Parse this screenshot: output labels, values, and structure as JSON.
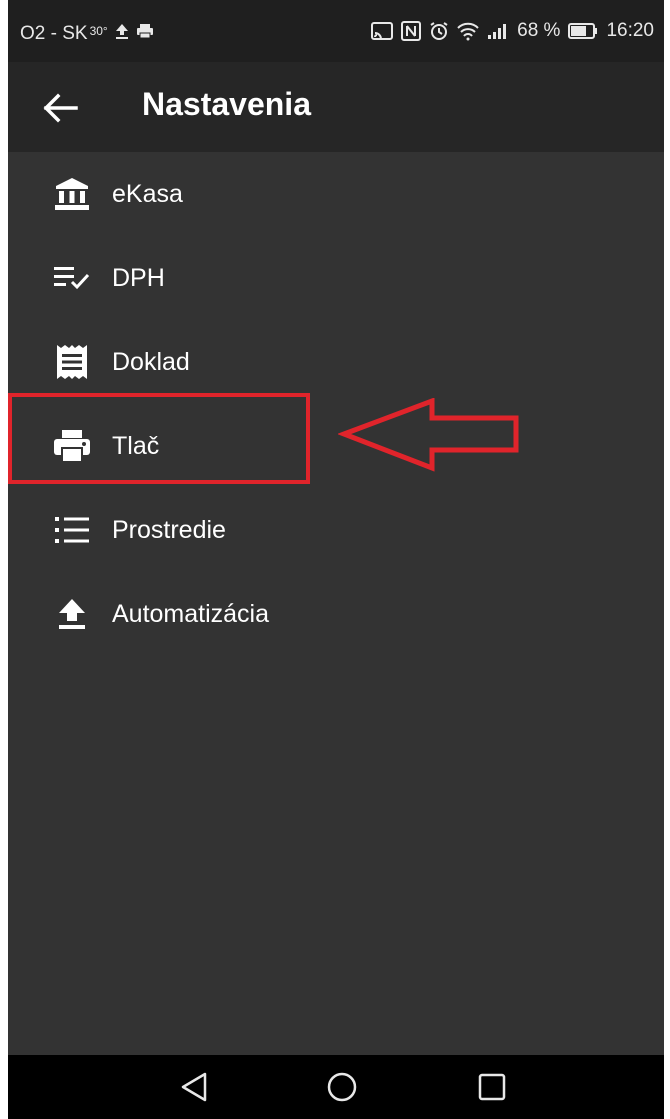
{
  "status_bar": {
    "carrier": "O2 - SK",
    "temperature": "30°",
    "battery": "68 %",
    "time": "16:20"
  },
  "app_bar": {
    "title": "Nastavenia",
    "back_icon": "arrow-left-icon"
  },
  "menu": {
    "items": [
      {
        "label": "eKasa",
        "icon": "bank-icon"
      },
      {
        "label": "DPH",
        "icon": "list-check-icon"
      },
      {
        "label": "Doklad",
        "icon": "receipt-icon"
      },
      {
        "label": "Tlač",
        "icon": "printer-icon"
      },
      {
        "label": "Prostredie",
        "icon": "list-icon"
      },
      {
        "label": "Automatizácia",
        "icon": "upload-icon"
      }
    ]
  },
  "annotation": {
    "highlighted_item": "Tlač",
    "color": "#e0242b"
  },
  "nav_bar": {
    "icons": [
      "back-triangle-icon",
      "home-circle-icon",
      "recents-square-icon"
    ]
  },
  "colors": {
    "background": "#333333",
    "app_bar": "#262626",
    "status_bar": "#1f1f1f",
    "text": "#ffffff"
  }
}
